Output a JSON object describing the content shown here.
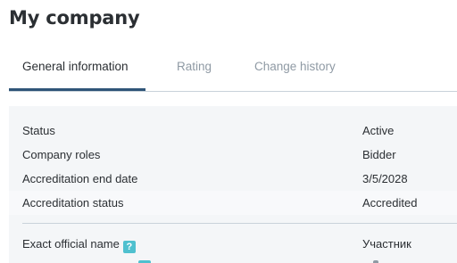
{
  "page": {
    "title": "My company"
  },
  "tabs": [
    {
      "label": "General information",
      "active": true
    },
    {
      "label": "Rating",
      "active": false
    },
    {
      "label": "Change history",
      "active": false
    }
  ],
  "info": {
    "rows": [
      {
        "label": "Status",
        "value": "Active"
      },
      {
        "label": "Company roles",
        "value": "Bidder"
      },
      {
        "label": "Accreditation end date",
        "value": "3/5/2028"
      },
      {
        "label": "Accreditation status",
        "value": "Accredited"
      }
    ],
    "official_name": {
      "label": "Exact official name",
      "help_icon": "?",
      "value": "Участник"
    }
  },
  "colors": {
    "accent": "#2f5578",
    "help": "#4fc0cf",
    "muted_tab": "#8f9aa4",
    "panel_bg": "#f4f6f8"
  }
}
